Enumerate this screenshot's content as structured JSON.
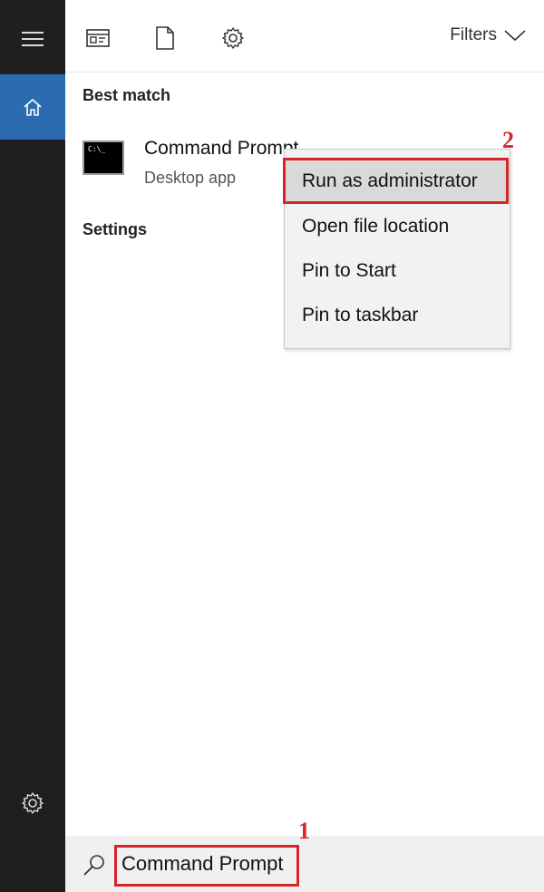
{
  "toolbar": {
    "filters_label": "Filters"
  },
  "results": {
    "best_match_label": "Best match",
    "settings_label": "Settings",
    "best_match": {
      "title": "Command Prompt",
      "subtitle": "Desktop app",
      "icon_text": "C:\\_"
    }
  },
  "context_menu": {
    "items": [
      {
        "label": "Run as administrator"
      },
      {
        "label": "Open file location"
      },
      {
        "label": "Pin to Start"
      },
      {
        "label": "Pin to taskbar"
      }
    ]
  },
  "search": {
    "value": "Command Prompt"
  },
  "annotations": {
    "step1": "1",
    "step2": "2"
  },
  "colors": {
    "rail_bg": "#1f1f1f",
    "home_active": "#2b6bb0",
    "highlight_red": "#d6262b",
    "menu_bg": "#f2f2f2",
    "menu_hover": "#d9d9d9"
  },
  "icons": [
    "hamburger-icon",
    "home-icon",
    "settings-gear-icon",
    "apps-icon",
    "document-icon",
    "gear-icon",
    "chevron-down-icon",
    "search-icon",
    "cmd-app-icon"
  ]
}
